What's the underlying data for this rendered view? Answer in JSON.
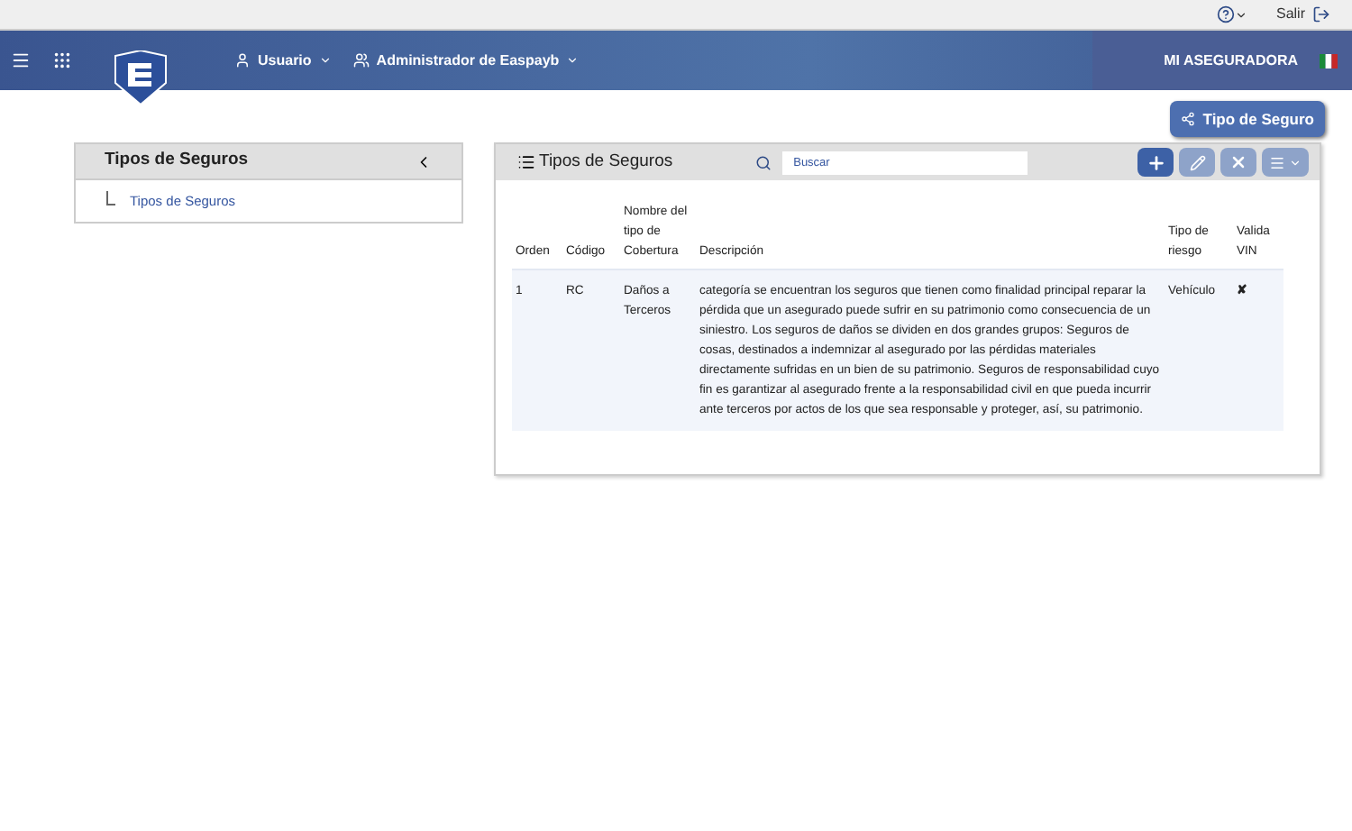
{
  "top_bar": {
    "logout": "Salir"
  },
  "header": {
    "menus": [
      {
        "label": "Usuario",
        "kind": "user"
      },
      {
        "label": "Administrador de Easpayb",
        "kind": "group"
      }
    ],
    "company": "MI ASEGURADORA"
  },
  "action_button": "Tipo de Seguro",
  "tree_panel": {
    "title": "Tipos de Seguros",
    "items": [
      {
        "label": "Tipos de Seguros",
        "selected": false
      }
    ]
  },
  "list_panel": {
    "title": "Tipos de Seguros",
    "search": {
      "placeholder": "Buscar"
    },
    "toolbar": [
      {
        "kind": "add",
        "disabled": false
      },
      {
        "kind": "edit",
        "disabled": true
      },
      {
        "kind": "delete",
        "disabled": true
      },
      {
        "kind": "menu",
        "disabled": true
      }
    ],
    "table": {
      "columns": [
        "Orden",
        "Código",
        "Nombre del tipo de Cobertura",
        "Descripción",
        "Tipo de riesgo",
        "Valida VIN"
      ],
      "rows": [
        [
          "1",
          "RC",
          "Daños a Terceros",
          "categoría se encuentran los seguros que tienen como finalidad principal reparar la pérdida que un asegurado puede sufrir en su patrimonio como consecuencia de un siniestro. Los seguros de daños se dividen en dos grandes grupos: Seguros de cosas, destinados a indemnizar al asegurado por las pérdidas materiales directamente sufridas en un bien de su patrimonio. Seguros de responsabilidad cuyo fin es garantizar al asegurado frente a la responsabilidad civil en que pueda incurrir ante terceros por actos de los que sea responsable y proteger, así, su patrimonio.",
          "Vehículo",
          "✘"
        ]
      ]
    }
  }
}
